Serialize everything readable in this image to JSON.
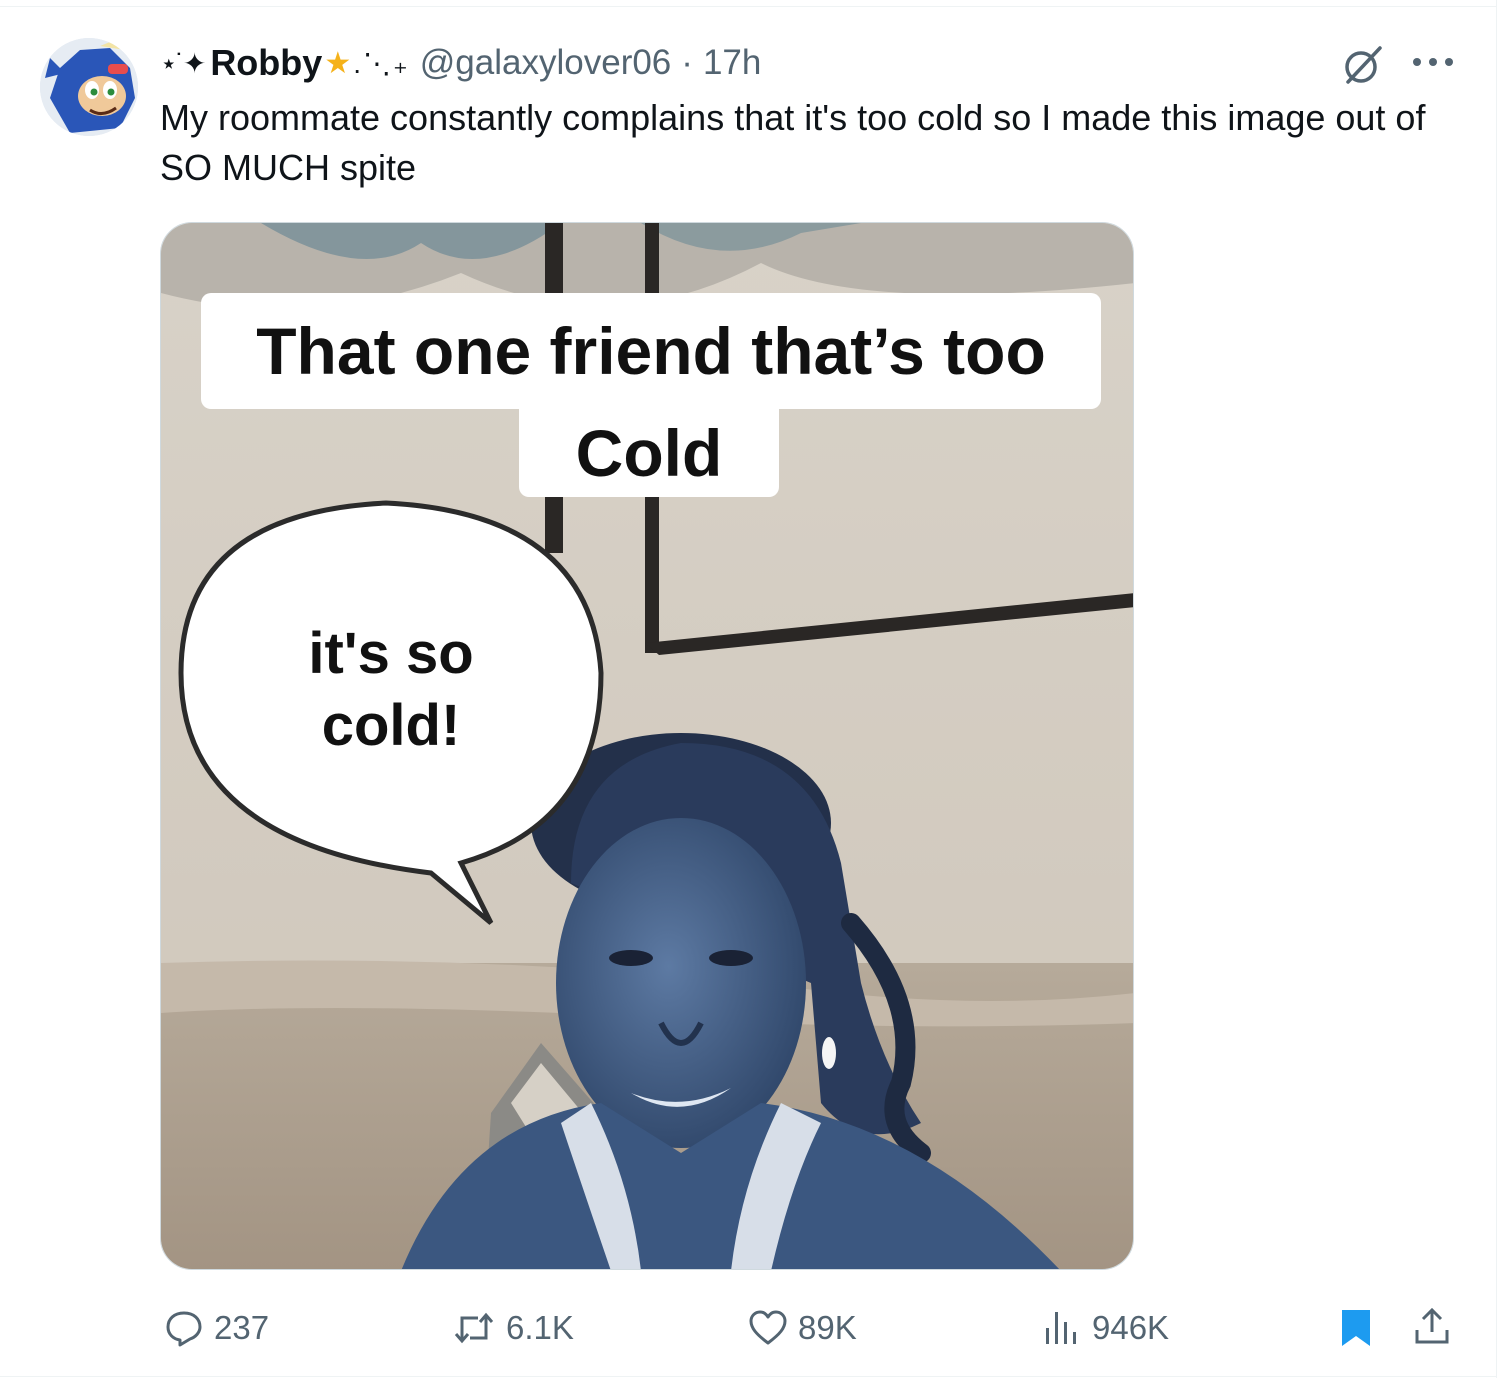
{
  "tweet": {
    "display_name": "Robby",
    "name_deco_left": "⋆˙✦",
    "name_deco_right": ".⋱₊",
    "handle": "@galaxylover06",
    "separator": "·",
    "time": "17h",
    "text": "My roommate constantly complains that it's too cold so I made this image out of SO MUCH spite"
  },
  "media": {
    "caption_line1": "That one friend that’s too",
    "caption_line2": "Cold",
    "bubble_line1": "it's so",
    "bubble_line2": "cold!"
  },
  "actions": {
    "replies": "237",
    "reposts": "6.1K",
    "likes": "89K",
    "views": "946K"
  },
  "colors": {
    "text": "#0f1419",
    "secondary": "#536471",
    "accent": "#1d9bf0",
    "border": "#cfd9de"
  },
  "icons": [
    "grok-icon",
    "more-icon",
    "reply-icon",
    "repost-icon",
    "like-icon",
    "views-icon",
    "bookmark-icon",
    "share-icon"
  ]
}
